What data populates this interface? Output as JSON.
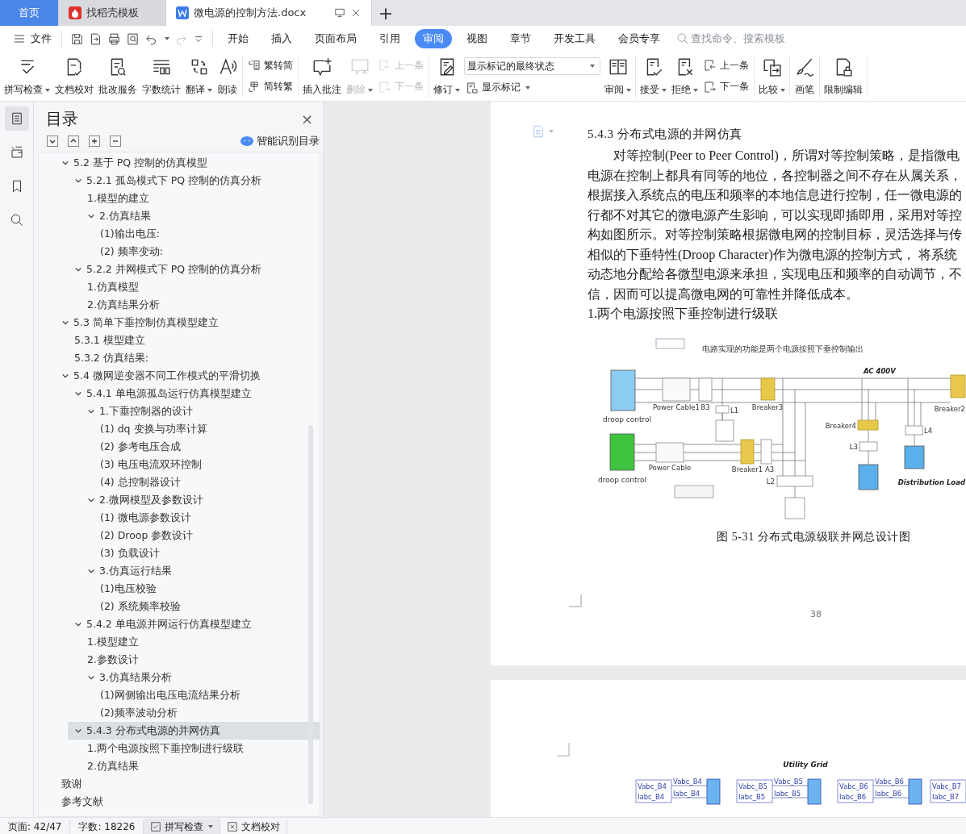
{
  "tabs": [
    {
      "label": "首页",
      "kind": "home",
      "selected": false
    },
    {
      "label": "找稻壳模板",
      "kind": "template",
      "selected": false
    },
    {
      "label": "微电源的控制方法.docx",
      "kind": "document",
      "selected": true
    }
  ],
  "new_tab": "+",
  "menu": {
    "file": "文件",
    "tabs": [
      {
        "label": "开始",
        "selected": false
      },
      {
        "label": "插入",
        "selected": false
      },
      {
        "label": "页面布局",
        "selected": false
      },
      {
        "label": "引用",
        "selected": false
      },
      {
        "label": "审阅",
        "selected": true
      },
      {
        "label": "视图",
        "selected": false
      },
      {
        "label": "章节",
        "selected": false
      },
      {
        "label": "开发工具",
        "selected": false
      },
      {
        "label": "会员专享",
        "selected": false
      }
    ],
    "search_placeholder": "查找命令、搜索模板"
  },
  "ribbon": [
    {
      "items": [
        {
          "kind": "large",
          "label": "拼写检查",
          "dropdown": true,
          "disabled": false
        },
        {
          "kind": "large",
          "label": "文档校对",
          "dropdown": false,
          "disabled": false
        },
        {
          "kind": "large",
          "label": "批改服务",
          "dropdown": false,
          "disabled": false
        },
        {
          "kind": "large",
          "label": "字数统计",
          "dropdown": false,
          "disabled": false
        },
        {
          "kind": "large",
          "label": "翻译",
          "dropdown": true,
          "disabled": false
        },
        {
          "kind": "large",
          "label": "朗读",
          "dropdown": false,
          "disabled": false
        }
      ]
    },
    {
      "items": [
        {
          "kind": "stack",
          "items": [
            {
              "kind": "small",
              "label": "繁转简",
              "dropdown": false,
              "disabled": false
            },
            {
              "kind": "small",
              "label": "简转繁",
              "dropdown": false,
              "disabled": false
            }
          ]
        }
      ]
    },
    {
      "items": [
        {
          "kind": "large",
          "label": "插入批注",
          "dropdown": false,
          "disabled": false
        },
        {
          "kind": "large",
          "label": "删除",
          "dropdown": true,
          "disabled": true
        },
        {
          "kind": "stack",
          "items": [
            {
              "kind": "small",
              "label": "上一条",
              "dropdown": false,
              "disabled": true
            },
            {
              "kind": "small",
              "label": "下一条",
              "dropdown": false,
              "disabled": true
            }
          ]
        }
      ]
    },
    {
      "items": [
        {
          "kind": "large",
          "label": "修订",
          "dropdown": true,
          "disabled": false
        },
        {
          "kind": "stack",
          "items": [
            {
              "kind": "select",
              "label": "显示标记的最终状态",
              "dropdown": true,
              "disabled": false
            },
            {
              "kind": "small",
              "label": "显示标记",
              "dropdown": true,
              "disabled": false
            }
          ]
        },
        {
          "kind": "large",
          "label": "审阅",
          "dropdown": true,
          "disabled": false
        }
      ]
    },
    {
      "items": [
        {
          "kind": "large",
          "label": "接受",
          "dropdown": true,
          "disabled": false
        },
        {
          "kind": "large",
          "label": "拒绝",
          "dropdown": true,
          "disabled": false
        },
        {
          "kind": "stack",
          "items": [
            {
              "kind": "small",
              "label": "上一条",
              "dropdown": false,
              "disabled": false
            },
            {
              "kind": "small",
              "label": "下一条",
              "dropdown": false,
              "disabled": false
            }
          ]
        }
      ]
    },
    {
      "items": [
        {
          "kind": "large",
          "label": "比较",
          "dropdown": true,
          "disabled": false
        }
      ]
    },
    {
      "items": [
        {
          "kind": "large",
          "label": "画笔",
          "dropdown": false,
          "disabled": false
        }
      ]
    },
    {
      "items": [
        {
          "kind": "large",
          "label": "限制编辑",
          "dropdown": false,
          "disabled": false
        }
      ]
    }
  ],
  "panel": {
    "title": "目录",
    "close": "×",
    "smart_toc": "智能识别目录",
    "tree": [
      {
        "label": "5.2  基于 PQ 控制的仿真模型",
        "expanded": true,
        "selected": false,
        "children": [
          {
            "label": "5.2.1  孤岛模式下 PQ 控制的仿真分析",
            "expanded": true,
            "selected": false,
            "children": [
              {
                "label": "1.模型的建立",
                "selected": false
              },
              {
                "label": "2.仿真结果",
                "expanded": true,
                "selected": false,
                "children": [
                  {
                    "label": "(1)输出电压:",
                    "selected": false
                  },
                  {
                    "label": " (2)  频率变动:",
                    "selected": false
                  }
                ]
              }
            ]
          },
          {
            "label": "5.2.2  并网模式下 PQ 控制的仿真分析",
            "expanded": true,
            "selected": false,
            "children": [
              {
                "label": "1.仿真模型",
                "selected": false
              },
              {
                "label": "2.仿真结果分析",
                "selected": false
              }
            ]
          }
        ]
      },
      {
        "label": "5.3  简单下垂控制仿真模型建立",
        "expanded": true,
        "selected": false,
        "children": [
          {
            "label": "5.3.1  模型建立",
            "selected": false
          },
          {
            "label": "5.3.2  仿真结果:",
            "selected": false
          }
        ]
      },
      {
        "label": "5.4  微网逆变器不同工作模式的平滑切换",
        "expanded": true,
        "selected": false,
        "children": [
          {
            "label": "5.4.1  单电源孤岛运行仿真模型建立",
            "expanded": true,
            "selected": false,
            "children": [
              {
                "label": "1.下垂控制器的设计",
                "expanded": true,
                "selected": false,
                "children": [
                  {
                    "label": "(1)  dq 变换与功率计算",
                    "selected": false
                  },
                  {
                    "label": " (2)  参考电压合成",
                    "selected": false
                  },
                  {
                    "label": " (3)  电压电流双环控制",
                    "selected": false
                  },
                  {
                    "label": "(4)  总控制器设计",
                    "selected": false
                  }
                ]
              },
              {
                "label": "2.微网模型及参数设计",
                "expanded": true,
                "selected": false,
                "children": [
                  {
                    "label": "(1)  微电源参数设计",
                    "selected": false
                  },
                  {
                    "label": "(2)  Droop 参数设计",
                    "selected": false
                  },
                  {
                    "label": "(3)  负载设计",
                    "selected": false
                  }
                ]
              },
              {
                "label": "3.仿真运行结果",
                "expanded": true,
                "selected": false,
                "children": [
                  {
                    "label": "(1)电压校验",
                    "selected": false
                  },
                  {
                    "label": "(2)  系统频率校验",
                    "selected": false
                  }
                ]
              }
            ]
          },
          {
            "label": "5.4.2  单电源并网运行仿真模型建立",
            "expanded": true,
            "selected": false,
            "children": [
              {
                "label": "1.模型建立",
                "selected": false
              },
              {
                "label": "2.参数设计",
                "selected": false
              },
              {
                "label": "3.仿真结果分析",
                "expanded": true,
                "selected": false,
                "children": [
                  {
                    "label": "(1)网侧输出电压电流结果分析",
                    "selected": false
                  },
                  {
                    "label": "(2)频率波动分析",
                    "selected": false
                  }
                ]
              }
            ]
          },
          {
            "label": "5.4.3 分布式电源的并网仿真",
            "expanded": true,
            "selected": true,
            "children": [
              {
                "label": "1.两个电源按照下垂控制进行级联",
                "selected": false
              },
              {
                "label": "2.仿真结果",
                "selected": false
              }
            ]
          }
        ]
      },
      {
        "label": "致谢",
        "selected": false
      },
      {
        "label": "参考文献",
        "selected": false
      }
    ]
  },
  "document": {
    "heading": "5.4.3 分布式电源的并网仿真",
    "paragraph": [
      "对等控制(Peer to Peer Control)，所谓对等控制策略，是指微电",
      "电源在控制上都具有同等的地位，各控制器之间不存在从属关系，",
      "根据接入系统点的电压和频率的本地信息进行控制，任一微电源的",
      "行都不对其它的微电源产生影响，可以实现即插即用，采用对等控",
      "构如图所示。对等控制策略根据微电网的控制目标，灵活选择与传",
      "相似的下垂特性(Droop Character)作为微电源的控制方式， 将系统",
      "动态地分配给各微型电源来承担，实现电压和频率的自动调节，不",
      "信，因而可以提高微电网的可靠性并降低成本。"
    ],
    "subheading": "1.两个电源按照下垂控制进行级联",
    "figure": {
      "note": "电路实现的功能是两个电源按照下垂控制输出",
      "bus_label": "AC 400V",
      "load_label": "Distribution Load",
      "sources": [
        {
          "label": "droop control",
          "color": "#8ccbf2"
        },
        {
          "label": "droop control",
          "color": "#3fc43f"
        }
      ],
      "blocks": [
        {
          "kind": "cable",
          "label": "Power Cable1"
        },
        {
          "kind": "meter",
          "label": "B3"
        },
        {
          "kind": "breaker",
          "label": "Breaker3"
        },
        {
          "kind": "meter",
          "label": "L1"
        },
        {
          "kind": "breaker",
          "label": "Breaker2"
        },
        {
          "kind": "breaker",
          "label": "Breaker4"
        },
        {
          "kind": "meter",
          "label": "L4"
        },
        {
          "kind": "meter",
          "label": "L3"
        },
        {
          "kind": "cable",
          "label": "Power Cable"
        },
        {
          "kind": "breaker",
          "label": "Breaker1"
        },
        {
          "kind": "meter",
          "label": "A3"
        },
        {
          "kind": "meter",
          "label": "L2"
        }
      ]
    },
    "caption": "图 5-31  分布式电源级联并网总设计图",
    "page_number": "38",
    "next_page": {
      "title": "Utility Grid",
      "units": [
        {
          "inputs": [
            "Vabc_B4",
            "Iabc_B4"
          ],
          "signals": [
            "Vabc_B4",
            "Iabc_B4"
          ]
        },
        {
          "inputs": [
            "Vabc_B5",
            "Iabc_B5"
          ],
          "signals": [
            "Vabc_B5",
            "Iabc_B5"
          ]
        },
        {
          "inputs": [
            "Vabc_B6",
            "Iabc_B6"
          ],
          "signals": [
            "Vabc_B6",
            "Iabc_B6"
          ]
        },
        {
          "inputs": [
            "Vabc_B7",
            "Iabc_B7"
          ]
        }
      ]
    }
  },
  "status": {
    "page": "页面: 42/47",
    "words": "字数: 18226",
    "buttons": [
      {
        "label": "拼写检查",
        "dropdown": true
      },
      {
        "label": "文档校对",
        "dropdown": false
      }
    ]
  }
}
